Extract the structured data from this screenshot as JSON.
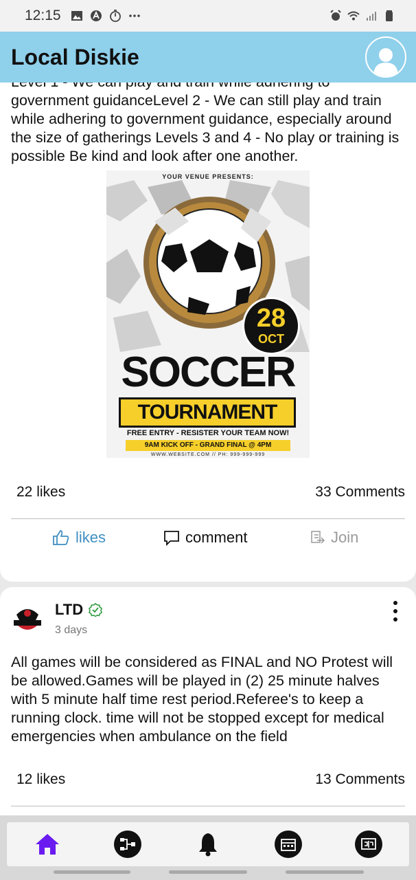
{
  "status": {
    "time": "12:15"
  },
  "appbar": {
    "title": "Local Diskie"
  },
  "post1": {
    "text": "Level 1 - We can play and train while adhering to government guidanceLevel 2 - We can still play and train while adhering to government guidance, especially around the size of gatherings Levels 3 and 4 - No play or training is possible Be kind and look after one another.",
    "poster": {
      "venue": "YOUR VENUE PRESENTS:",
      "day": "28",
      "month": "OCT",
      "headline": "SOCCER",
      "subheadline": "TOURNAMENT",
      "entry": "FREE ENTRY - RESISTER YOUR TEAM NOW!",
      "kickoff": "9AM KICK OFF - GRAND FINAL @ 4PM",
      "web": "WWW.WEBSITE.COM // PH: 999-999-999"
    },
    "likes": "22 likes",
    "comments": "33 Comments"
  },
  "actions": {
    "like": "likes",
    "comment": "comment",
    "join": "Join"
  },
  "post2": {
    "author": "LTD",
    "time": "3 days",
    "text": "All games will be considered as FINAL and NO Protest will be allowed.Games will be played in (2) 25 minute halves with 5 minute half time rest period.Referee's to keep a running clock. time will not be stopped except for medical emergencies when ambulance on the field",
    "likes": "12 likes",
    "comments": "13 Comments"
  },
  "colors": {
    "appbar": "#8fd0eb",
    "like_blue": "#3f8fc2",
    "nav_active": "#6a1bf0",
    "verified": "#2e9a3e",
    "poster_yellow": "#f6cf2a"
  },
  "icons": [
    "home-icon",
    "bracket-icon",
    "bell-icon",
    "calendar-icon",
    "scoreboard-icon"
  ]
}
